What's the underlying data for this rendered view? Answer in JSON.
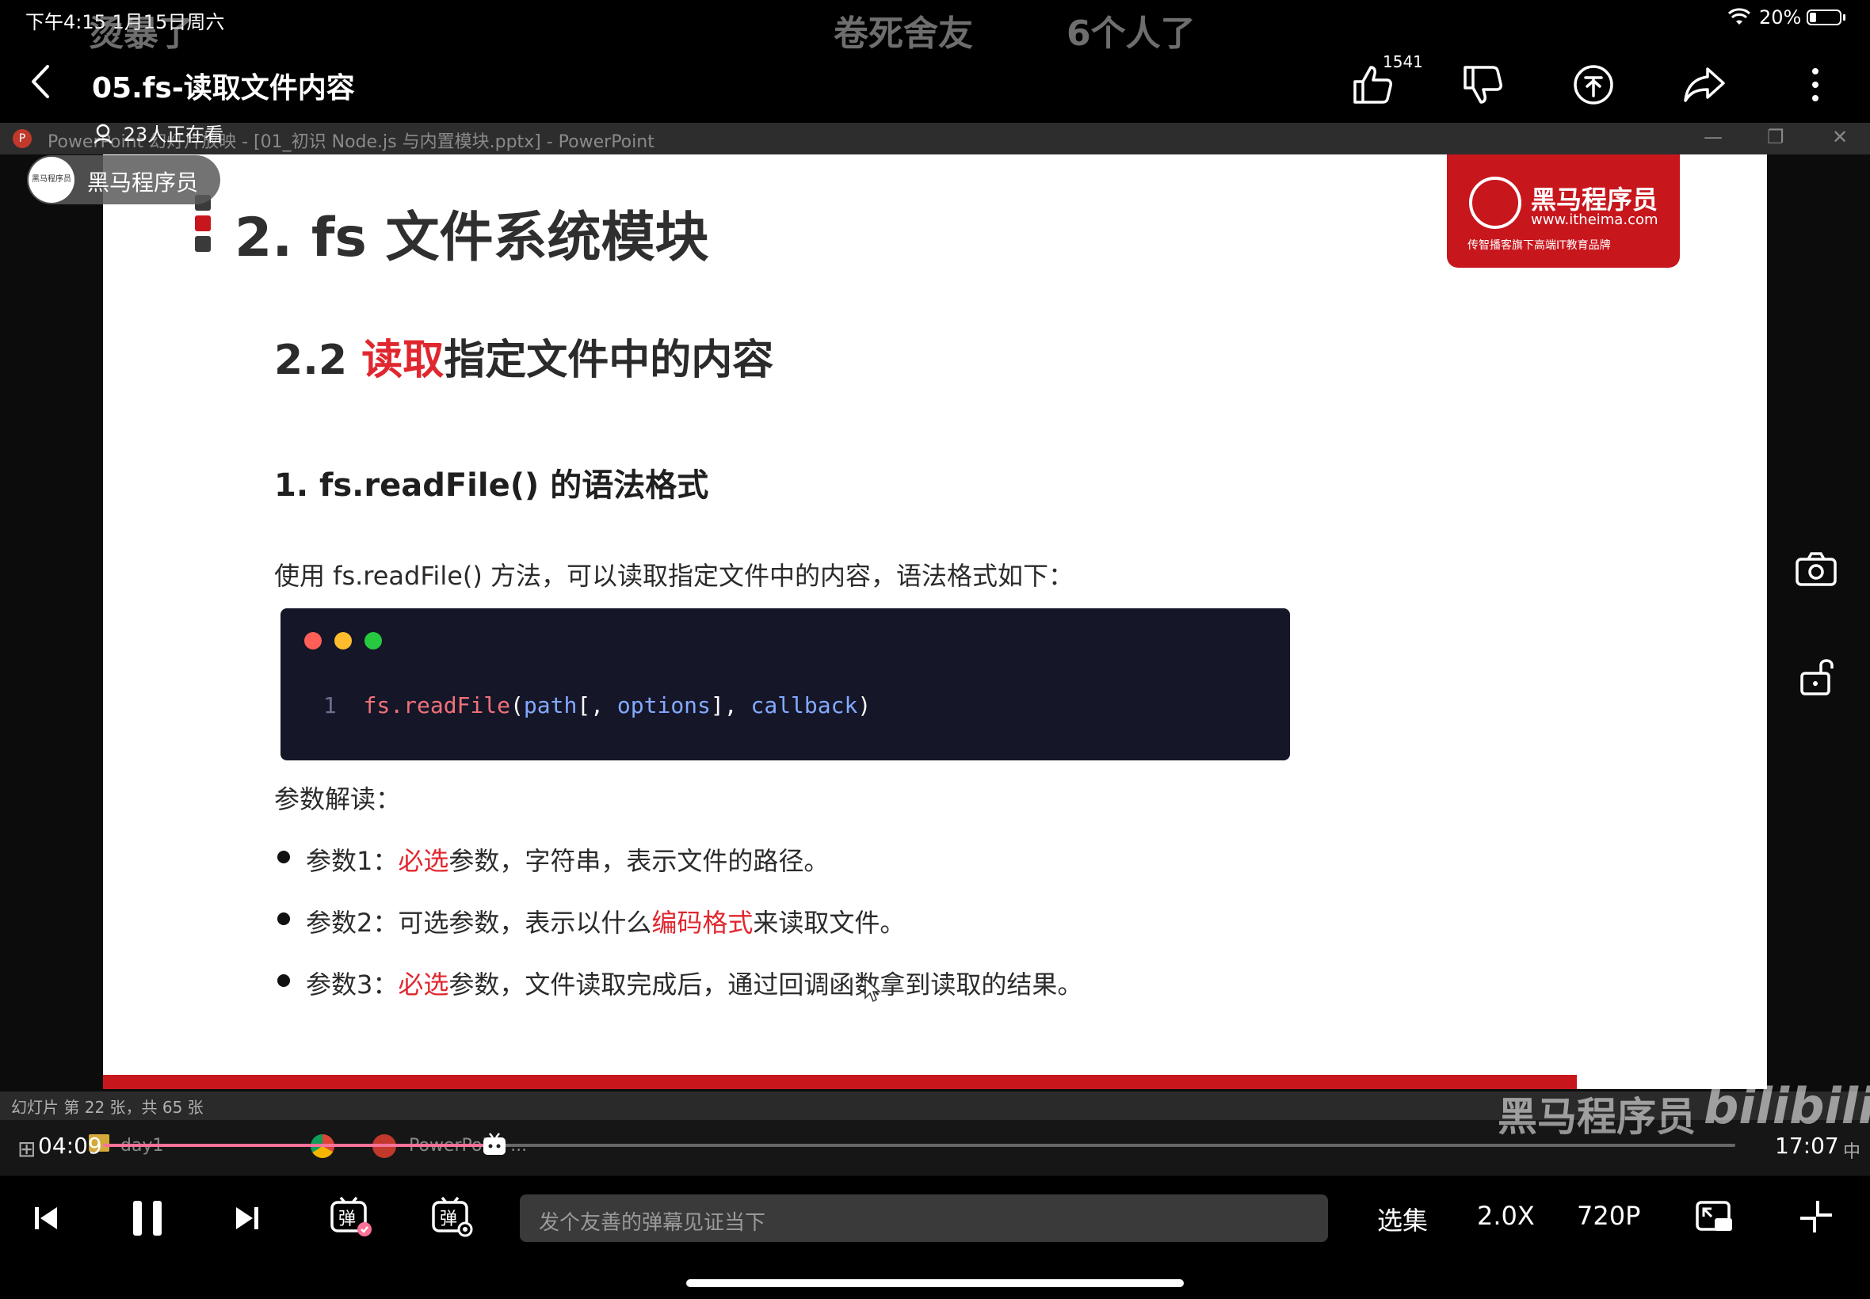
{
  "status": {
    "time": "下午4:15  1月15日周六",
    "battery": "20%"
  },
  "danmaku": [
    "烫暴了",
    "卷死舍友",
    "6个人了"
  ],
  "header": {
    "title": "05.fs-读取文件内容",
    "like_count": "1541",
    "viewers": "23人正在看"
  },
  "ppt": {
    "titlebar": "PowerPoint 幻灯片放映 - [01_初识 Node.js 与内置模块.pptx] - PowerPoint",
    "status": "幻灯片 第 22 张，共 65 张"
  },
  "channel": {
    "name": "黑马程序员",
    "logo_text": "黑马程序员"
  },
  "slide": {
    "title": "2. fs 文件系统模块",
    "brand": {
      "name": "黑马程序员",
      "url": "www.itheima.com",
      "tagline": "传智播客旗下高端IT教育品牌"
    },
    "h2_prefix": "2.2 ",
    "h2_red": "读取",
    "h2_rest": "指定文件中的内容",
    "h3": "1. fs.readFile() 的语法格式",
    "intro": "使用 fs.readFile() 方法，可以读取指定文件中的内容，语法格式如下：",
    "code": {
      "line_no": "1",
      "fn": "fs.readFile",
      "open": "(",
      "p1": "path",
      "b1": "[, ",
      "p2": "options",
      "b2": "], ",
      "p3": "callback",
      "close": ")"
    },
    "param_title": "参数解读：",
    "bullets": [
      {
        "a": "参数1：",
        "red": "必选",
        "b": "参数，字符串，表示文件的路径。"
      },
      {
        "a": "参数2：可选参数，表示以什么",
        "red": "编码格式",
        "b": "来读取文件。"
      },
      {
        "a": "参数3：",
        "red": "必选",
        "b": "参数，文件读取完成后，通过回调函数拿到读取的结果。"
      }
    ]
  },
  "taskbar": {
    "folder": "day1",
    "ppt": "PowerPoint ..."
  },
  "watermark": {
    "brand": "黑马程序员",
    "site": "bilibili"
  },
  "player": {
    "current": "04:09",
    "duration": "17:07",
    "progress": 0.24,
    "lang": "中"
  },
  "controls": {
    "placeholder": "发个友善的弹幕见证当下",
    "episodes": "选集",
    "speed": "2.0X",
    "quality": "720P"
  }
}
